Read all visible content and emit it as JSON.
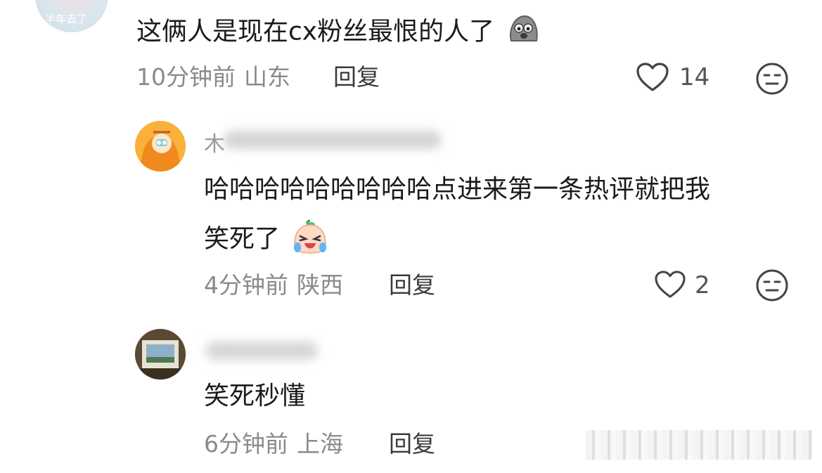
{
  "comment1": {
    "avatar_text": "半年去了",
    "text": "这俩人是现在cx粉丝最恨的人了",
    "emoji": "doge-sticker-icon",
    "time": "10分钟前",
    "location": "山东",
    "reply_label": "回复",
    "likes": "14"
  },
  "reply1": {
    "username_initial": "木",
    "text_line1": "哈哈哈哈哈哈哈哈哈点进来第一条热评就把我",
    "text_line2": "笑死了",
    "emoji": "crying-laughing-sticker-icon",
    "time": "4分钟前",
    "location": "陕西",
    "reply_label": "回复",
    "likes": "2"
  },
  "reply2": {
    "text": "笑死秒懂",
    "time": "6分钟前",
    "location": "上海",
    "reply_label": "回复"
  },
  "colors": {
    "text": "#1b1b1b",
    "meta": "#8a8a8a",
    "icon": "#444444",
    "background": "#ffffff"
  }
}
